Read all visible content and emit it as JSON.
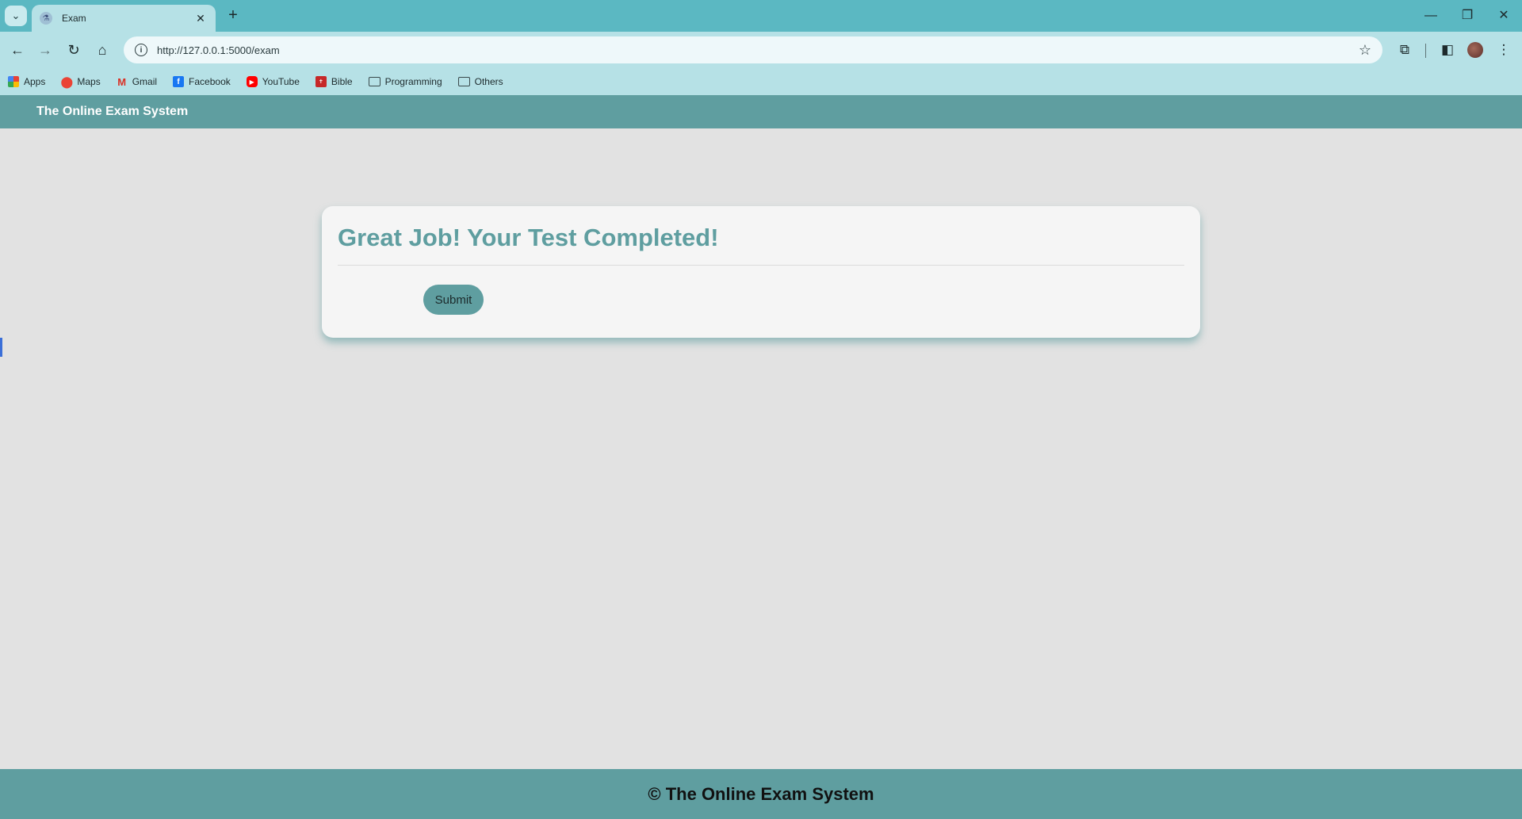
{
  "browser": {
    "tab": {
      "title": "Exam",
      "favicon": "flask-icon",
      "close_glyph": "✕"
    },
    "new_tab_glyph": "+",
    "tab_menu_glyph": "⌄",
    "window": {
      "minimize": "—",
      "restore": "❐",
      "close": "✕"
    },
    "toolbar": {
      "back": "←",
      "forward": "→",
      "reload": "↻",
      "home": "⌂",
      "info": "i",
      "url": "http://127.0.0.1:5000/exam",
      "star": "☆",
      "extensions": "⧉",
      "sidepanel": "◧",
      "menu": "⋮"
    },
    "bookmarks": [
      {
        "label": "Apps",
        "icon": "apps-icon"
      },
      {
        "label": "Maps",
        "icon": "maps-icon"
      },
      {
        "label": "Gmail",
        "icon": "gmail-icon"
      },
      {
        "label": "Facebook",
        "icon": "facebook-icon"
      },
      {
        "label": "YouTube",
        "icon": "youtube-icon"
      },
      {
        "label": "Bible",
        "icon": "bible-icon"
      },
      {
        "label": "Programming",
        "icon": "folder-icon"
      },
      {
        "label": "Others",
        "icon": "folder-icon"
      }
    ]
  },
  "page": {
    "brand": "The Online Exam System",
    "card": {
      "title": "Great Job! Your Test Completed!",
      "submit_label": "Submit"
    },
    "footer": "© The Online Exam System"
  },
  "colors": {
    "accent": "#5f9ea0",
    "browser_frame": "#5bb8c2",
    "toolbar": "#b6e1e6",
    "page_bg": "#e2e2e2",
    "card_bg": "#f5f5f5"
  }
}
